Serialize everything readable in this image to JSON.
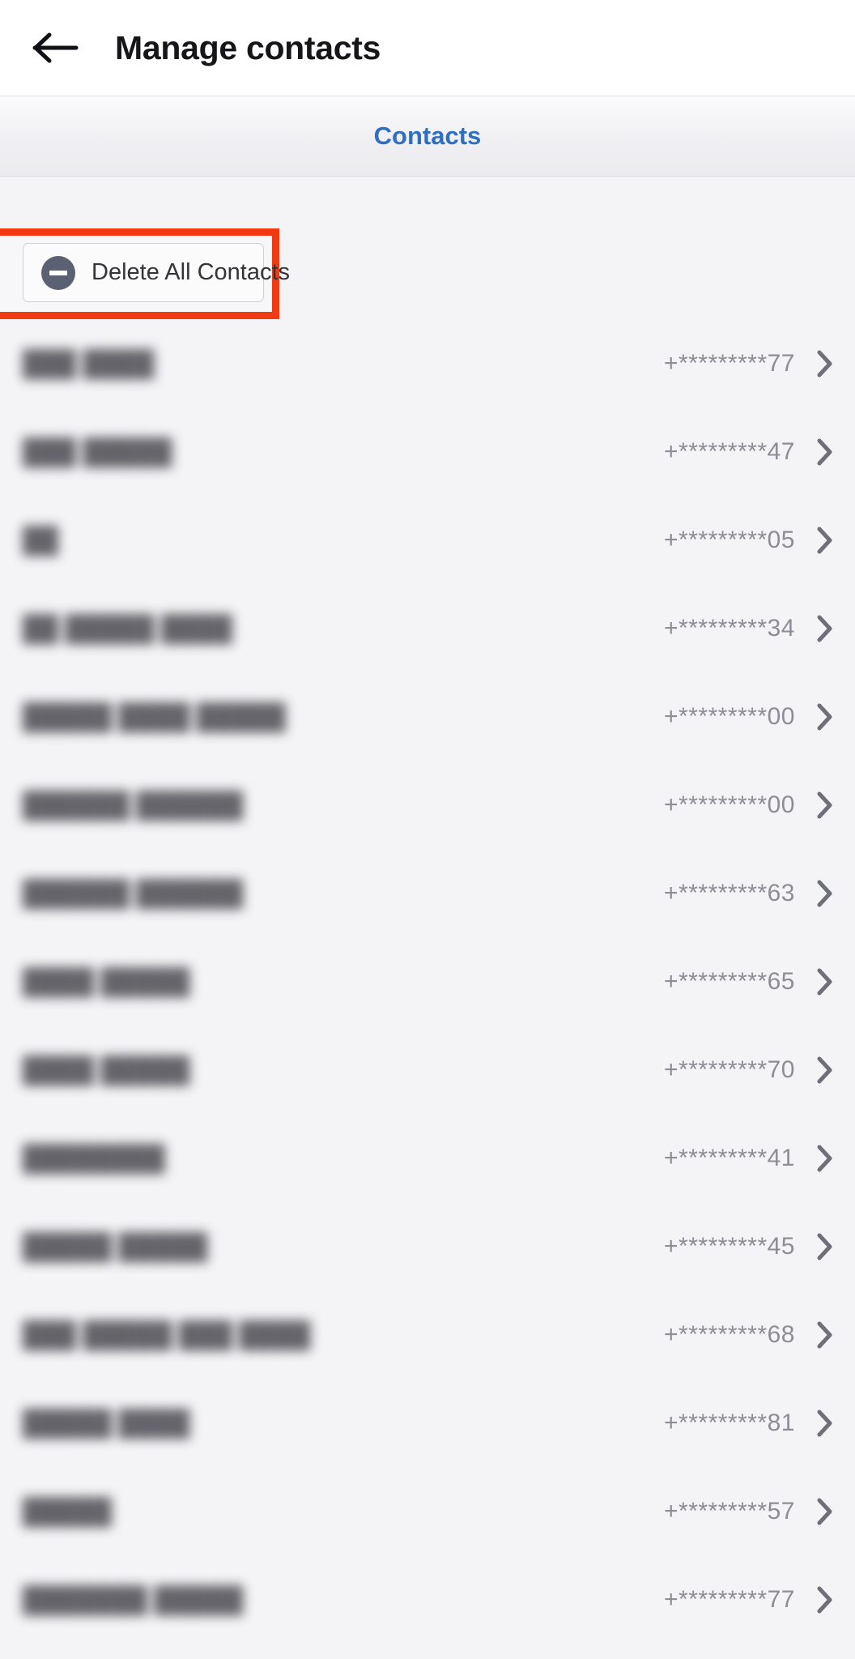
{
  "header": {
    "back_icon": "arrow-left-icon",
    "title": "Manage contacts"
  },
  "tabs": [
    {
      "label": "Contacts",
      "selected": true
    }
  ],
  "toolbar": {
    "delete_all_label": "Delete All Contacts",
    "delete_all_icon": "minus-circle-icon",
    "highlight_color": "#f23a12"
  },
  "colors": {
    "accent_blue": "#2f6fc0",
    "highlight_red": "#f23a12",
    "icon_slate": "#5c6073",
    "page_background": "#f4f4f6",
    "phone_text": "#8d8d96"
  },
  "contacts": [
    {
      "name": "███ ████",
      "phone": "+*********77",
      "chevron": "chevron-right-icon"
    },
    {
      "name": "███ █████",
      "phone": "+*********47",
      "chevron": "chevron-right-icon"
    },
    {
      "name": "██",
      "phone": "+*********05",
      "chevron": "chevron-right-icon"
    },
    {
      "name": "██ █████ ████",
      "phone": "+*********34",
      "chevron": "chevron-right-icon"
    },
    {
      "name": "█████ ████ █████",
      "phone": "+*********00",
      "chevron": "chevron-right-icon"
    },
    {
      "name": "██████ ██████",
      "phone": "+*********00",
      "chevron": "chevron-right-icon"
    },
    {
      "name": "██████ ██████",
      "phone": "+*********63",
      "chevron": "chevron-right-icon"
    },
    {
      "name": "████ █████",
      "phone": "+*********65",
      "chevron": "chevron-right-icon"
    },
    {
      "name": "████ █████",
      "phone": "+*********70",
      "chevron": "chevron-right-icon"
    },
    {
      "name": "████████",
      "phone": "+*********41",
      "chevron": "chevron-right-icon"
    },
    {
      "name": "█████ █████",
      "phone": "+*********45",
      "chevron": "chevron-right-icon"
    },
    {
      "name": "███ █████ ███ ████",
      "phone": "+*********68",
      "chevron": "chevron-right-icon"
    },
    {
      "name": "█████ ████",
      "phone": "+*********81",
      "chevron": "chevron-right-icon"
    },
    {
      "name": "█████",
      "phone": "+*********57",
      "chevron": "chevron-right-icon"
    },
    {
      "name": "███████ █████",
      "phone": "+*********77",
      "chevron": "chevron-right-icon"
    }
  ]
}
